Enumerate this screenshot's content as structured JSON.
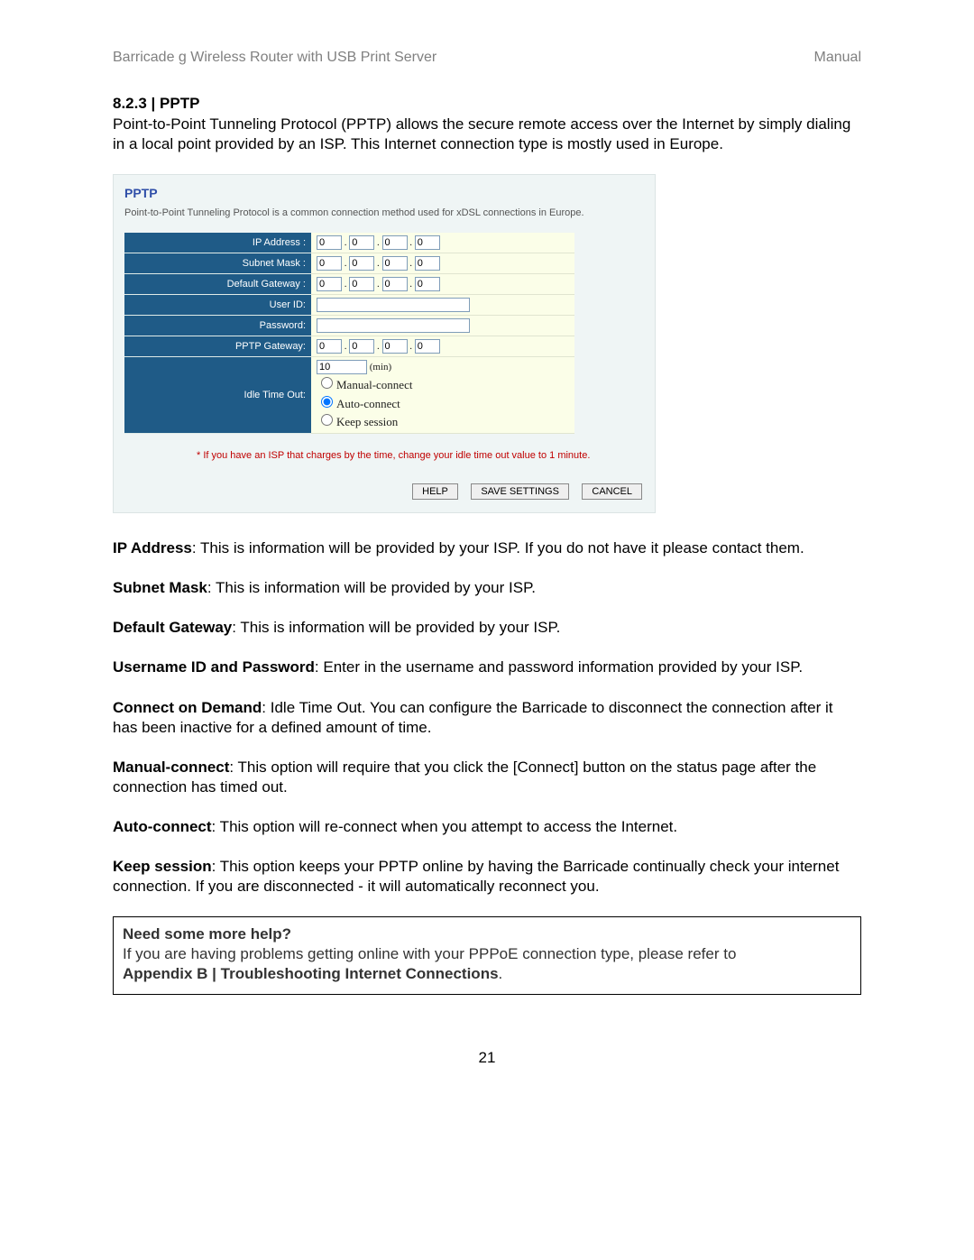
{
  "header": {
    "left": "Barricade g Wireless Router with USB Print Server",
    "right": "Manual"
  },
  "section": {
    "number": "8.2.3 | PPTP",
    "intro": "Point-to-Point Tunneling Protocol (PPTP) allows the secure remote access over the Internet by simply dialing in a local point provided by an ISP. This Internet connection type is mostly used in Europe."
  },
  "panel": {
    "title": "PPTP",
    "subtitle": "Point-to-Point Tunneling Protocol is a common connection method used for xDSL connections in Europe.",
    "rows": {
      "ip_label": "IP Address :",
      "subnet_label": "Subnet Mask :",
      "gateway_label": "Default Gateway :",
      "user_label": "User ID:",
      "pass_label": "Password:",
      "pptp_label": "PPTP Gateway:",
      "idle_label": "Idle Time Out:"
    },
    "ip": [
      "0",
      "0",
      "0",
      "0"
    ],
    "subnet": [
      "0",
      "0",
      "0",
      "0"
    ],
    "gateway": [
      "0",
      "0",
      "0",
      "0"
    ],
    "pptp": [
      "0",
      "0",
      "0",
      "0"
    ],
    "user_id": "",
    "password": "",
    "idle": {
      "value": "10",
      "unit": "(min)",
      "opt_manual": "Manual-connect",
      "opt_auto": "Auto-connect",
      "opt_keep": "Keep session",
      "selected": "auto"
    },
    "note": "* If you have an ISP that charges by the time, change your idle time out value to 1 minute.",
    "buttons": {
      "help": "HELP",
      "save": "SAVE SETTINGS",
      "cancel": "CANCEL"
    }
  },
  "desc": {
    "ip_b": "IP Address",
    "ip_t": ": This is information will be provided by your ISP.  If you do not have it please contact them.",
    "subnet_b": "Subnet Mask",
    "subnet_t": ": This is information will be provided by your ISP.",
    "gateway_b": "Default Gateway",
    "gateway_t": ": This is information will be provided by your ISP.",
    "user_b": "Username ID and Password",
    "user_t": ": Enter in the username and password information provided by your ISP.",
    "cod_b": "Connect on Demand",
    "cod_t": ":  Idle Time Out. You can configure the Barricade to disconnect the connection after it has been inactive for a defined amount of time.",
    "manual_b": "Manual-connect",
    "manual_t": ": This option will require that you click the [Connect] button on the status page after the connection has timed out.",
    "auto_b": "Auto-connect",
    "auto_t": ": This option will re-connect when you attempt to access the Internet.",
    "keep_b": "Keep session",
    "keep_t": ": This option keeps your PPTP online by having the Barricade continually check your internet connection.  If you are disconnected - it will automatically reconnect you."
  },
  "helpbox": {
    "heading": "Need some more help?",
    "line": "If you are having problems getting online with your PPPoE connection type, please refer to",
    "appendix": "Appendix B | Troubleshooting Internet Connections"
  },
  "page_number": "21"
}
